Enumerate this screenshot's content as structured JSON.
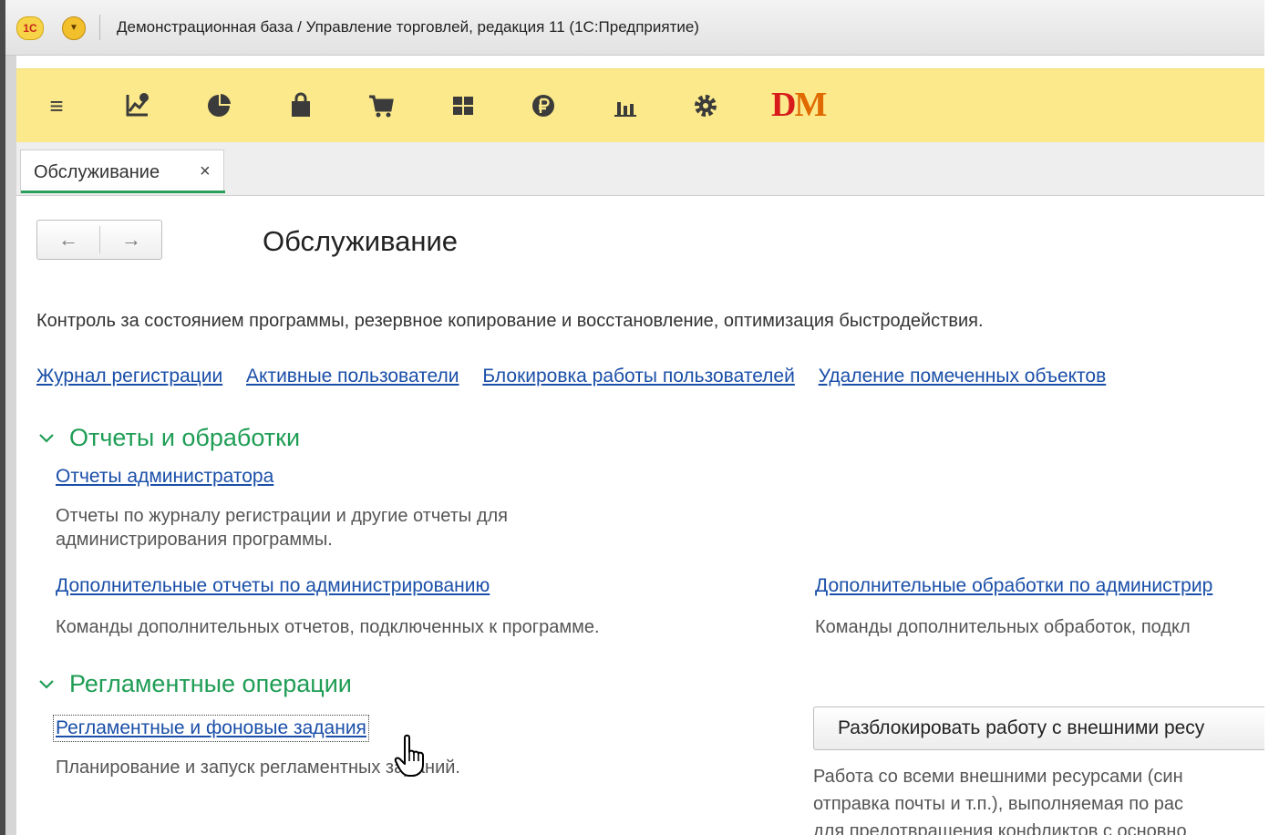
{
  "window": {
    "title": "Демонстрационная база / Управление торговлей, редакция 11  (1С:Предприятие)",
    "logo_text": "1С"
  },
  "toolbar": {
    "icons": [
      "menu-icon",
      "key-indicators-icon",
      "pie-chart-icon",
      "bag-icon",
      "cart-icon",
      "grid-icon",
      "ruble-icon",
      "bar-chart-icon",
      "gear-icon",
      "dm-logo"
    ],
    "accent_color": "#fbe98b"
  },
  "tabs": [
    {
      "label": "Обслуживание",
      "close": "×"
    }
  ],
  "page": {
    "title": "Обслуживание",
    "description": "Контроль за состоянием программы, резервное копирование и восстановление, оптимизация быстродействия.",
    "links": [
      "Журнал регистрации",
      "Активные пользователи",
      "Блокировка работы пользователей",
      "Удаление помеченных объектов"
    ]
  },
  "sections": {
    "reports": {
      "title": "Отчеты и обработки",
      "admin_reports_link": "Отчеты администратора",
      "admin_reports_desc_line1": "Отчеты по журналу регистрации и другие отчеты для",
      "admin_reports_desc_line2": "администрирования программы.",
      "extra_reports_link": "Дополнительные отчеты по администрированию",
      "extra_reports_desc": "Команды дополнительных отчетов, подключенных к программе.",
      "extra_processing_link": "Дополнительные обработки по администрир",
      "extra_processing_desc": "Команды дополнительных обработок, подкл"
    },
    "routine": {
      "title": "Регламентные операции",
      "jobs_link": "Регламентные и фоновые задания",
      "jobs_desc": "Планирование и запуск регламентных заданий.",
      "unlock_button": "Разблокировать работу с внешними ресу",
      "unlock_desc_line1": "Работа со всеми внешними ресурсами (син",
      "unlock_desc_line2": "отправка почты и т.п.), выполняемая по рас",
      "unlock_desc_line3": "для предотвращения конфликтов с основно"
    }
  },
  "colors": {
    "link": "#1a4fa8",
    "section_heading": "#1f9d55",
    "tab_underline": "#2aa05a"
  }
}
